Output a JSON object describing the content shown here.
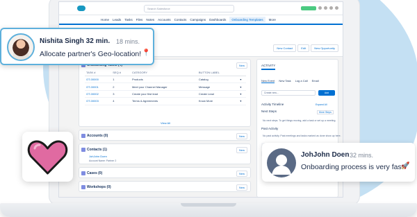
{
  "app": {
    "search_placeholder": "Search Salesforce",
    "nav_items": [
      "Home",
      "Leads",
      "Tasks",
      "Files",
      "Notes",
      "Accounts",
      "Contacts",
      "Campaigns",
      "Dashboards",
      "Onboarding Templates",
      "More"
    ],
    "active_nav_index": 9,
    "header_buttons": [
      "New Contact",
      "Edit",
      "New Opportunity"
    ]
  },
  "onboarding_tasks": {
    "title": "Onboarding Tasks (4)",
    "new_label": "New",
    "columns": [
      "TASK #",
      "SEQ #",
      "CATEGORY",
      "BUTTON LABEL"
    ],
    "rows": [
      [
        "OT-00000",
        "1",
        "Products",
        "Catalog"
      ],
      [
        "OT-00001",
        "2",
        "Meet your Channel Manager",
        "Message"
      ],
      [
        "OT-00002",
        "3",
        "Create your first lead",
        "Create Lead"
      ],
      [
        "OT-00003",
        "4",
        "Terms & Agreements",
        "Know More"
      ]
    ],
    "view_all": "View All"
  },
  "accounts": {
    "title": "Accounts (0)",
    "new_label": "New"
  },
  "contacts": {
    "title": "Contacts (1)",
    "new_label": "New",
    "contact_name": "JohJohn Doen",
    "contact_meta": "Account Name:   Partner 2"
  },
  "cases": {
    "title": "Cases (0)",
    "new_label": "New"
  },
  "workshops": {
    "title": "Workshops (0)",
    "new_label": "New"
  },
  "activity": {
    "tab": "ACTIVITY",
    "subtabs": [
      "New Event",
      "New Task",
      "Log a Call",
      "Email"
    ],
    "input_placeholder": "Create new...",
    "add_label": "Add",
    "timeline_label": "Activity Timeline",
    "expand_all": "Expand All",
    "next_steps_label": "Next Steps",
    "more_steps": "More Steps",
    "next_steps_text": "No next steps. To get things moving, add a task or set up a meeting.",
    "past_activity_label": "Past Activity",
    "past_activity_text": "No past activity. Past meetings and tasks marked as done show up here."
  },
  "notification_1": {
    "name": "Nishita Singh 32 min.",
    "time": "18 mins.",
    "message": "Allocate partner's Geo-location!",
    "pin_icon": "📍"
  },
  "notification_2": {
    "name": "JohJohn Doen",
    "time": "32 mins.",
    "message": "Onboarding process is very fast",
    "rocket_icon": "🚀"
  },
  "colors": {
    "brand": "#0070d2",
    "accent_blob": "#c4e0f3",
    "heart": "#e06aa1",
    "heart_outline": "#1b1b1b"
  }
}
